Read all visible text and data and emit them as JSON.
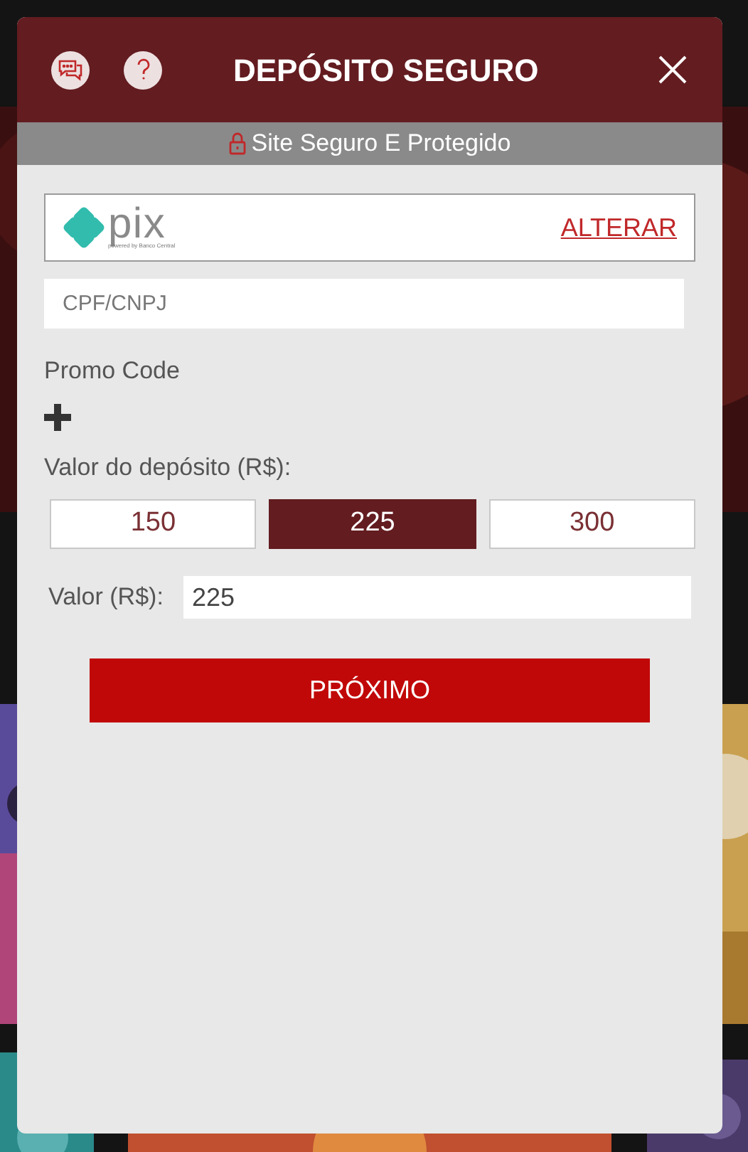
{
  "modal": {
    "title": "DEPÓSITO SEGURO",
    "security_note": "Site Seguro E Protegido"
  },
  "payment_method": {
    "logo_text": "pix",
    "logo_caption": "powered by Banco Central",
    "change_link": "ALTERAR"
  },
  "document_field": {
    "placeholder": "CPF/CNPJ"
  },
  "promo_code": {
    "label": "Promo Code",
    "expanded": false
  },
  "amount_label": "Valor do depósito (R$):",
  "amount_options": [
    {
      "label": "150",
      "selected": false
    },
    {
      "label": "225",
      "selected": true
    },
    {
      "label": "300",
      "selected": false
    }
  ],
  "amount_field": {
    "label": "Valor (R$):",
    "value": "225"
  },
  "submit_button": "PRÓXIMO"
}
